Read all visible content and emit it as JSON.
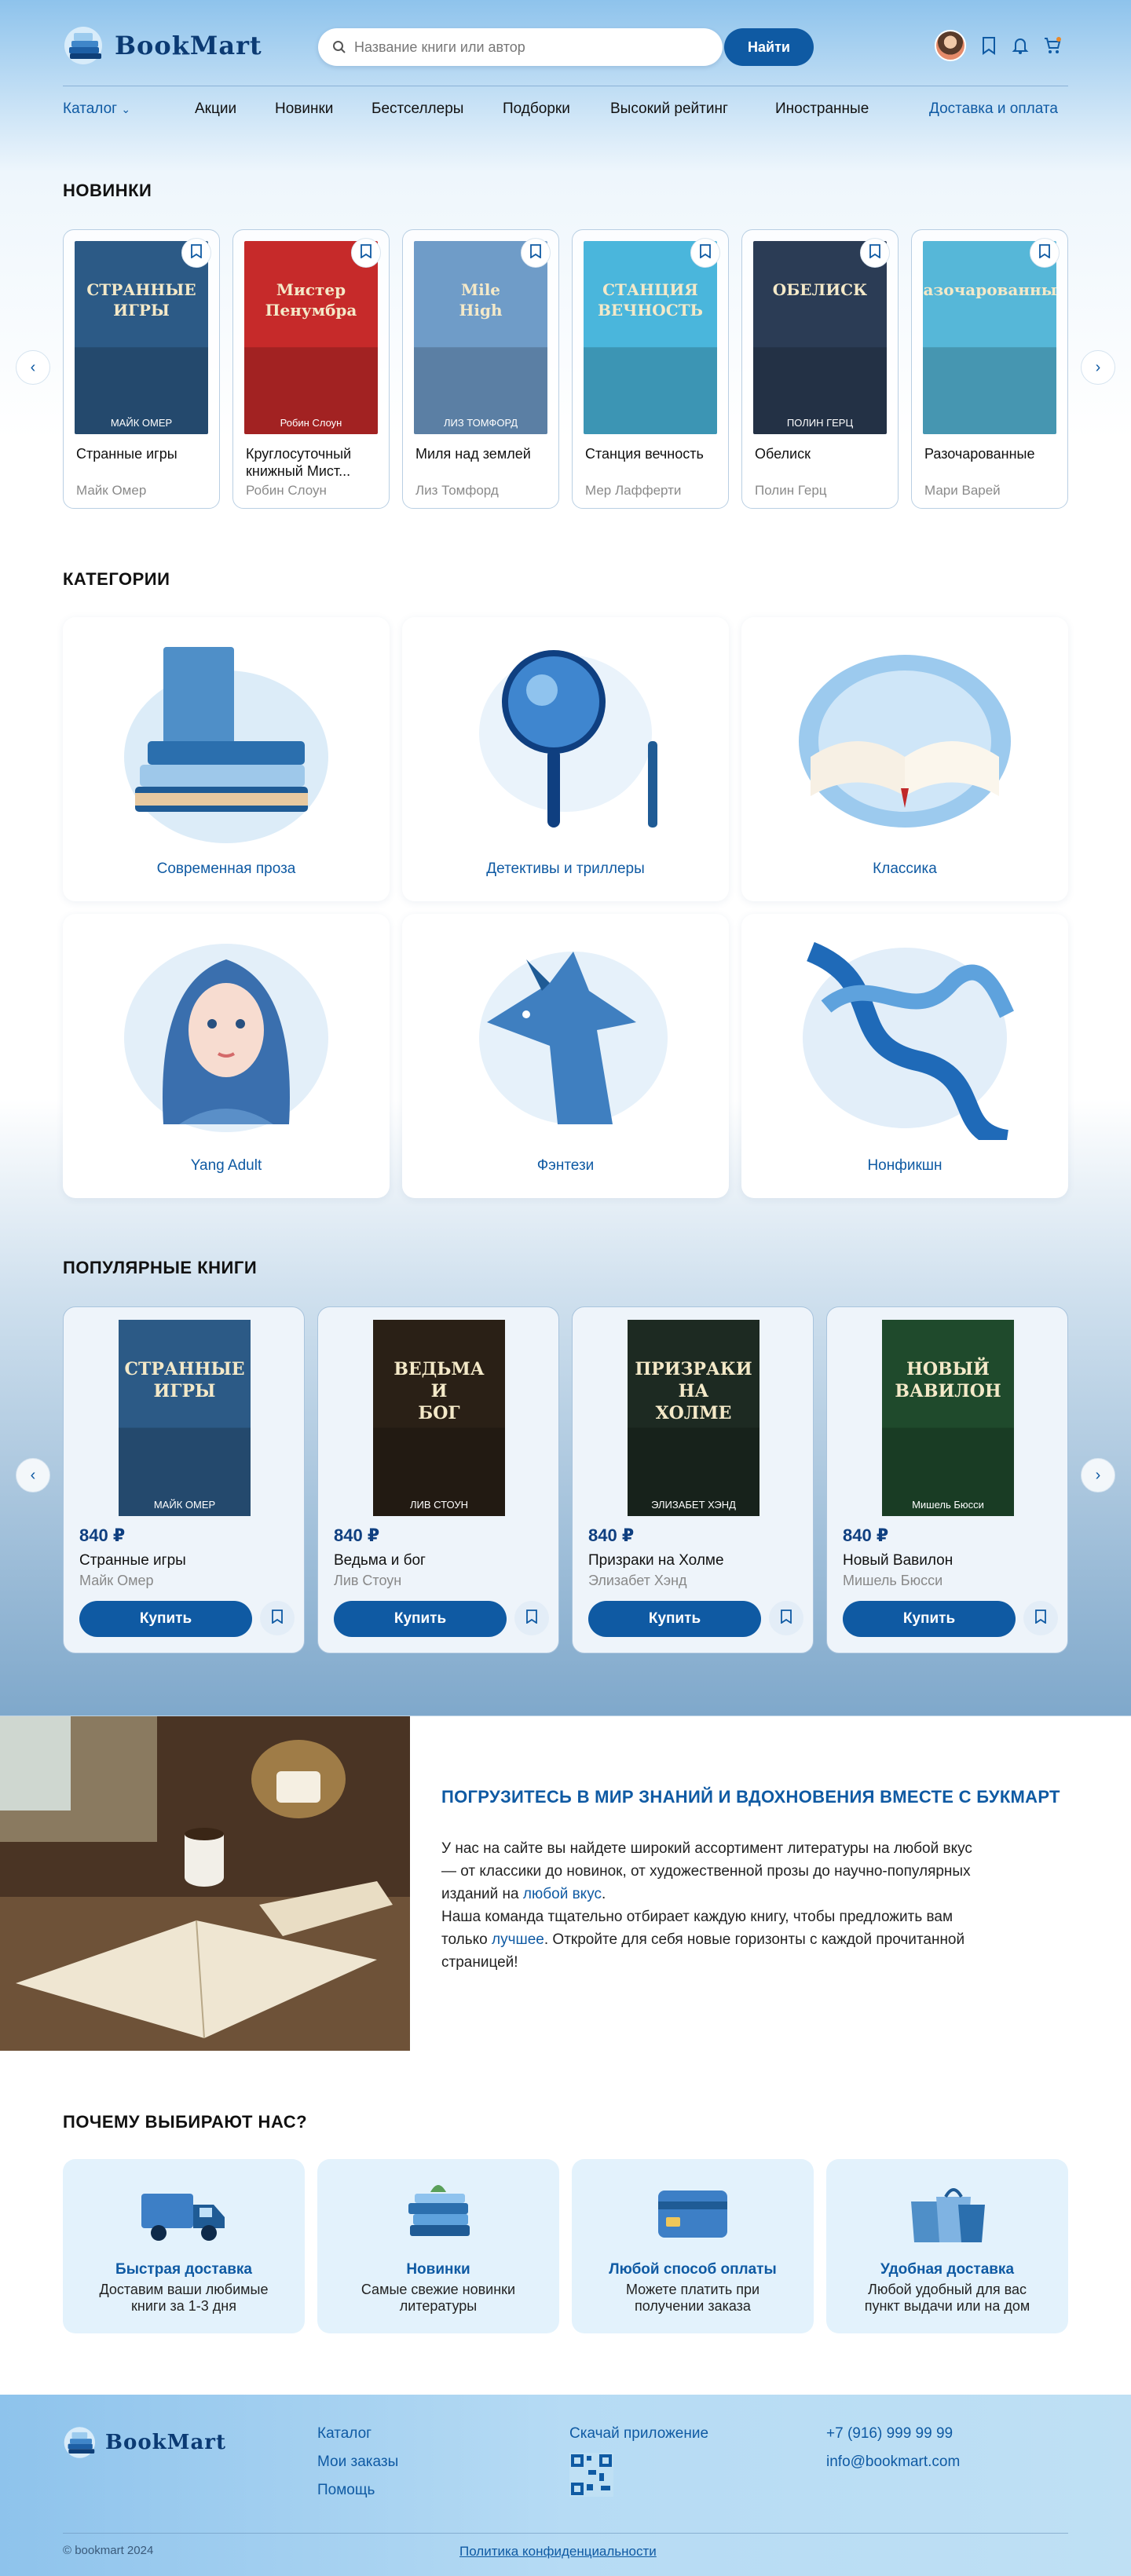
{
  "header": {
    "logo_text": "BookMart",
    "search_placeholder": "Название книги или автор",
    "search_button": "Найти"
  },
  "nav": {
    "catalog": "Каталог",
    "items": [
      "Акции",
      "Новинки",
      "Бестселлеры",
      "Подборки",
      "Высокий рейтинг",
      "Иностранные"
    ],
    "delivery": "Доставка и оплата"
  },
  "new_books": {
    "title": "НОВИНКИ",
    "items": [
      {
        "title": "Странные игры",
        "author": "Майк Омер",
        "cover_text": "СТРАННЫЕ ИГРЫ",
        "cover_author": "МАЙК ОМЕР",
        "color": "#2c5a86"
      },
      {
        "title": "Круглосуточный книжный Мист...",
        "author": "Робин Слоун",
        "cover_text": "Мистер Пенумбра",
        "cover_author": "Робин Слоун",
        "color": "#c62a2a"
      },
      {
        "title": "Миля над землей",
        "author": "Лиз Томфорд",
        "cover_text": "Mile High",
        "cover_author": "ЛИЗ ТОМФОРД",
        "color": "#6f9cc8"
      },
      {
        "title": "Станция вечность",
        "author": "Мер Лафферти",
        "cover_text": "СТАНЦИЯ ВЕЧНОСТЬ",
        "cover_author": "",
        "color": "#4ab6dc"
      },
      {
        "title": "Обелиск",
        "author": "Полин Герц",
        "cover_text": "ОБЕЛИСК",
        "cover_author": "ПОЛИН ГЕРЦ",
        "color": "#2b3c55"
      },
      {
        "title": "Разочарованные",
        "author": "Мари Варей",
        "cover_text": "разочарованные",
        "cover_author": "",
        "color": "#56b7d8"
      }
    ]
  },
  "categories": {
    "title": "КАТЕГОРИИ",
    "items": [
      "Современная проза",
      "Детективы и триллеры",
      "Классика",
      "Yang Adult",
      "Фэнтези",
      "Нонфикшн"
    ]
  },
  "popular": {
    "title": "ПОПУЛЯРНЫЕ КНИГИ",
    "buy_label": "Купить",
    "items": [
      {
        "price": "840 ₽",
        "title": "Странные игры",
        "author": "Майк Омер",
        "cover_text": "СТРАННЫЕ ИГРЫ",
        "cover_author": "МАЙК ОМЕР",
        "color": "#2c5a86"
      },
      {
        "price": "840 ₽",
        "title": "Ведьма и бог",
        "author": "Лив Стоун",
        "cover_text": "ВЕДЬМА И БОГ",
        "cover_author": "ЛИВ СТОУН",
        "color": "#2a2016"
      },
      {
        "price": "840 ₽",
        "title": "Призраки на Холме",
        "author": "Элизабет Хэнд",
        "cover_text": "ПРИЗРАКИ НА ХОЛМЕ",
        "cover_author": "ЭЛИЗАБЕТ ХЭНД",
        "color": "#1d2a22"
      },
      {
        "price": "840 ₽",
        "title": "Новый Вавилон",
        "author": "Мишель Бюсси",
        "cover_text": "НОВЫЙ ВАВИЛОН",
        "cover_author": "Мишель Бюсси",
        "color": "#1f4a2c"
      }
    ]
  },
  "about": {
    "title": "ПОГРУЗИТЕСЬ В МИР ЗНАНИЙ И ВДОХНОВЕНИЯ ВМЕСТЕ С БУКМАРТ",
    "p1_a": "У нас на сайте вы найдете широкий ассортимент литературы на любой вкус — от классики до новинок, от художественной прозы до научно-популярных изданий на ",
    "p1_hl": "любой вкус",
    "p1_b": ".",
    "p2_a": "Наша команда тщательно отбирает каждую книгу, чтобы предложить вам только ",
    "p2_hl": "лучшее",
    "p2_b": ". Откройте для себя новые горизонты с каждой прочитанной страницей!"
  },
  "why": {
    "title": "ПОЧЕМУ ВЫБИРАЮТ НАС?",
    "items": [
      {
        "title": "Быстрая доставка",
        "desc": "Доставим ваши любимые книги за 1-3 дня"
      },
      {
        "title": "Новинки",
        "desc": "Самые свежие новинки литературы"
      },
      {
        "title": "Любой способ оплаты",
        "desc": "Можете платить при получении заказа"
      },
      {
        "title": "Удобная доставка",
        "desc": "Любой удобный для вас пункт выдачи или на дом"
      }
    ]
  },
  "footer": {
    "logo_text": "BookMart",
    "links": [
      "Каталог",
      "Мои заказы",
      "Помощь"
    ],
    "app": "Скачай приложение",
    "phone": "+7 (916) 999 99 99",
    "email": "info@bookmart.com",
    "copyright": "© bookmart 2024",
    "privacy": "Политика конфиденциальности"
  }
}
